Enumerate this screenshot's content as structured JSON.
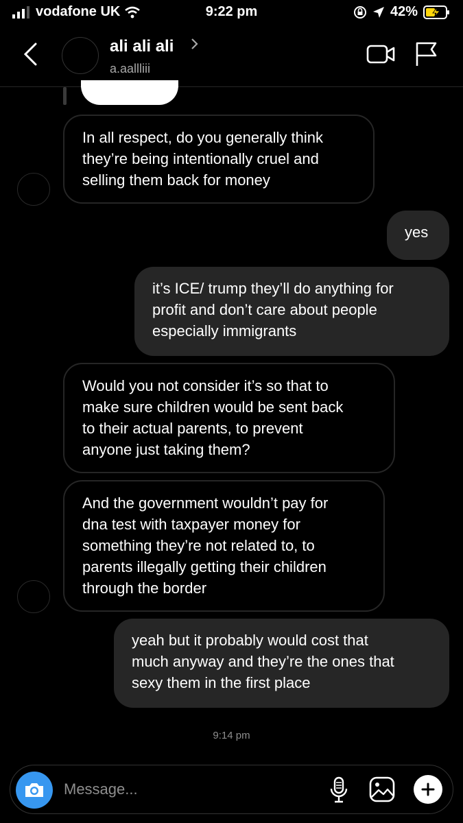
{
  "status_bar": {
    "carrier": "vodafone UK",
    "time": "9:22 pm",
    "battery": "42%"
  },
  "header": {
    "name": "ali ali ali",
    "username": "a.aallliii"
  },
  "messages": [
    {
      "direction": "in",
      "text": "In all respect, do you generally think\nthey’re being intentionally cruel and\nselling them back for money"
    },
    {
      "direction": "out",
      "text": "yes"
    },
    {
      "direction": "out",
      "text": "it’s ICE/ trump they’ll do anything for\nprofit and don’t care about people\nespecially immigrants"
    },
    {
      "direction": "in",
      "text": "Would you not consider it’s so that to\nmake sure children would be sent back\nto their actual parents, to prevent\nanyone just taking them?"
    },
    {
      "direction": "in",
      "text": "And the government wouldn’t pay for\ndna test with taxpayer money for\nsomething they’re not related to, to\nparents illegally getting their children\nthrough the border"
    },
    {
      "direction": "out",
      "text": "yeah but it probably would cost that\nmuch anyway and they’re the ones that\nsexy them in the first place"
    }
  ],
  "timestamp": "9:14 pm",
  "composer": {
    "placeholder": "Message..."
  },
  "icons": [
    "signal-icon",
    "wifi-icon",
    "lock-rotation-icon",
    "location-icon",
    "battery-icon",
    "back-icon",
    "chevron-right-icon",
    "video-call-icon",
    "flag-icon",
    "camera-icon",
    "microphone-icon",
    "gallery-icon",
    "plus-icon"
  ],
  "colors": {
    "background": "#000000",
    "bubble": "#262626",
    "accent": "#3797f0",
    "battery": "#ffd60a"
  }
}
